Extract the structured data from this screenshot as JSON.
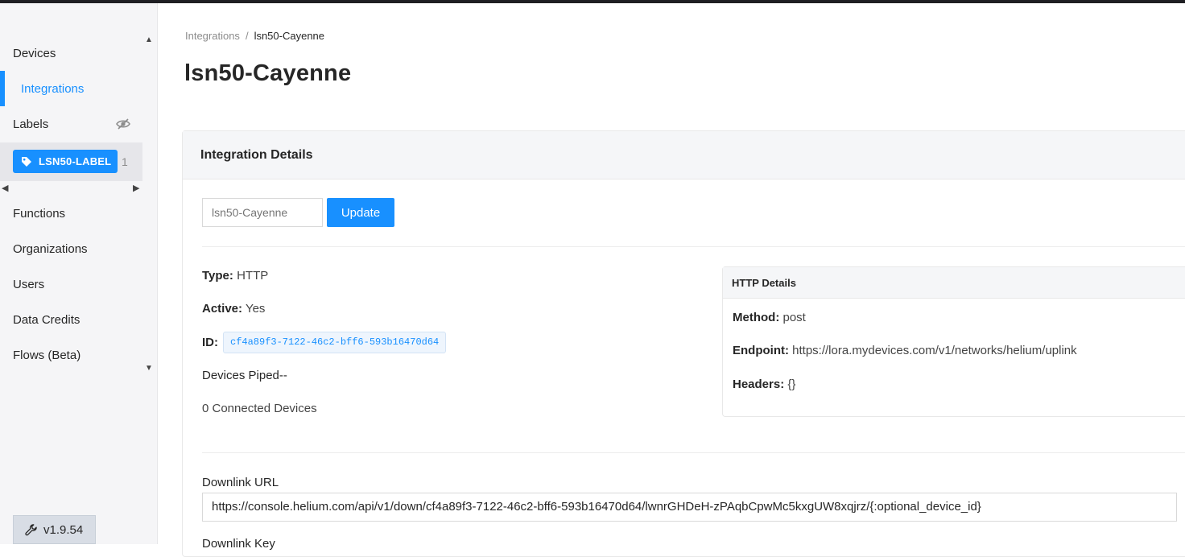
{
  "sidebar": {
    "items": [
      {
        "label": "Devices"
      },
      {
        "label": "Integrations"
      },
      {
        "label": "Labels"
      },
      {
        "label": "Functions"
      },
      {
        "label": "Organizations"
      },
      {
        "label": "Users"
      },
      {
        "label": "Data Credits"
      },
      {
        "label": "Flows (Beta)"
      }
    ],
    "label_tag": {
      "name": "LSN50-LABEL",
      "count": "1"
    },
    "version": "v1.9.54"
  },
  "breadcrumb": {
    "parent": "Integrations",
    "separator": "/",
    "current": "lsn50-Cayenne"
  },
  "page_title": "lsn50-Cayenne",
  "details": {
    "section_title": "Integration Details",
    "name_input": {
      "value": "",
      "placeholder": "lsn50-Cayenne"
    },
    "update_label": "Update",
    "type_label": "Type:",
    "type_value": "HTTP",
    "active_label": "Active:",
    "active_value": "Yes",
    "id_label": "ID:",
    "id_value": "cf4a89f3-7122-46c2-bff6-593b16470d64",
    "devices_piped": "Devices Piped--",
    "connected_devices": "0 Connected Devices"
  },
  "http_details": {
    "title": "HTTP Details",
    "method_label": "Method:",
    "method_value": "post",
    "endpoint_label": "Endpoint:",
    "endpoint_value": "https://lora.mydevices.com/v1/networks/helium/uplink",
    "headers_label": "Headers:",
    "headers_value": "{}"
  },
  "downlink": {
    "url_label": "Downlink URL",
    "url_value": "https://console.helium.com/api/v1/down/cf4a89f3-7122-46c2-bff6-593b16470d64/lwnrGHDeH-zPAqbCpwMc5kxgUW8xqjrz/{:optional_device_id}",
    "key_label": "Downlink Key"
  },
  "colors": {
    "accent": "#1890ff",
    "sidebar_bg": "#f5f5f7",
    "topbar": "#1f1f23"
  }
}
